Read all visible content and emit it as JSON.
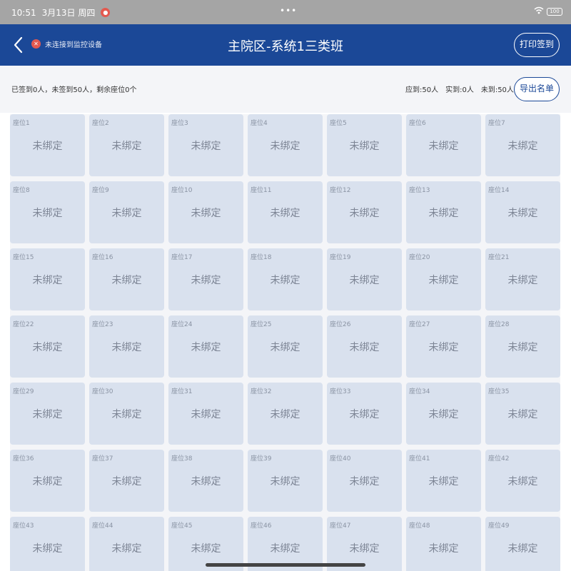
{
  "status_bar": {
    "time": "10:51",
    "date": "3月13日 周四",
    "center_dots": "•••",
    "battery": "100"
  },
  "header": {
    "alert_text": "未连接到监控设备",
    "title": "主院区-系统1三类班",
    "print_label": "打印签到"
  },
  "summary": {
    "left_text": "已签到0人，未签到50人，剩余座位0个",
    "stats": [
      "应到:50人",
      "实到:0人",
      "未到:50人"
    ],
    "stats_button": "导出名单"
  },
  "seats": [
    {
      "no": "座位1",
      "status": "未绑定"
    },
    {
      "no": "座位2",
      "status": "未绑定"
    },
    {
      "no": "座位3",
      "status": "未绑定"
    },
    {
      "no": "座位4",
      "status": "未绑定"
    },
    {
      "no": "座位5",
      "status": "未绑定"
    },
    {
      "no": "座位6",
      "status": "未绑定"
    },
    {
      "no": "座位7",
      "status": "未绑定"
    },
    {
      "no": "座位8",
      "status": "未绑定"
    },
    {
      "no": "座位9",
      "status": "未绑定"
    },
    {
      "no": "座位10",
      "status": "未绑定"
    },
    {
      "no": "座位11",
      "status": "未绑定"
    },
    {
      "no": "座位12",
      "status": "未绑定"
    },
    {
      "no": "座位13",
      "status": "未绑定"
    },
    {
      "no": "座位14",
      "status": "未绑定"
    },
    {
      "no": "座位15",
      "status": "未绑定"
    },
    {
      "no": "座位16",
      "status": "未绑定"
    },
    {
      "no": "座位17",
      "status": "未绑定"
    },
    {
      "no": "座位18",
      "status": "未绑定"
    },
    {
      "no": "座位19",
      "status": "未绑定"
    },
    {
      "no": "座位20",
      "status": "未绑定"
    },
    {
      "no": "座位21",
      "status": "未绑定"
    },
    {
      "no": "座位22",
      "status": "未绑定"
    },
    {
      "no": "座位23",
      "status": "未绑定"
    },
    {
      "no": "座位24",
      "status": "未绑定"
    },
    {
      "no": "座位25",
      "status": "未绑定"
    },
    {
      "no": "座位26",
      "status": "未绑定"
    },
    {
      "no": "座位27",
      "status": "未绑定"
    },
    {
      "no": "座位28",
      "status": "未绑定"
    },
    {
      "no": "座位29",
      "status": "未绑定"
    },
    {
      "no": "座位30",
      "status": "未绑定"
    },
    {
      "no": "座位31",
      "status": "未绑定"
    },
    {
      "no": "座位32",
      "status": "未绑定"
    },
    {
      "no": "座位33",
      "status": "未绑定"
    },
    {
      "no": "座位34",
      "status": "未绑定"
    },
    {
      "no": "座位35",
      "status": "未绑定"
    },
    {
      "no": "座位36",
      "status": "未绑定"
    },
    {
      "no": "座位37",
      "status": "未绑定"
    },
    {
      "no": "座位38",
      "status": "未绑定"
    },
    {
      "no": "座位39",
      "status": "未绑定"
    },
    {
      "no": "座位40",
      "status": "未绑定"
    },
    {
      "no": "座位41",
      "status": "未绑定"
    },
    {
      "no": "座位42",
      "status": "未绑定"
    },
    {
      "no": "座位43",
      "status": "未绑定"
    },
    {
      "no": "座位44",
      "status": "未绑定"
    },
    {
      "no": "座位45",
      "status": "未绑定"
    },
    {
      "no": "座位46",
      "status": "未绑定"
    },
    {
      "no": "座位47",
      "status": "未绑定"
    },
    {
      "no": "座位48",
      "status": "未绑定"
    },
    {
      "no": "座位49",
      "status": "未绑定"
    }
  ],
  "colors": {
    "header_bg": "#1b4897",
    "status_bar_bg": "#a5a5a5",
    "seat_bg": "#d9e1ee",
    "alert": "#e3594f"
  }
}
